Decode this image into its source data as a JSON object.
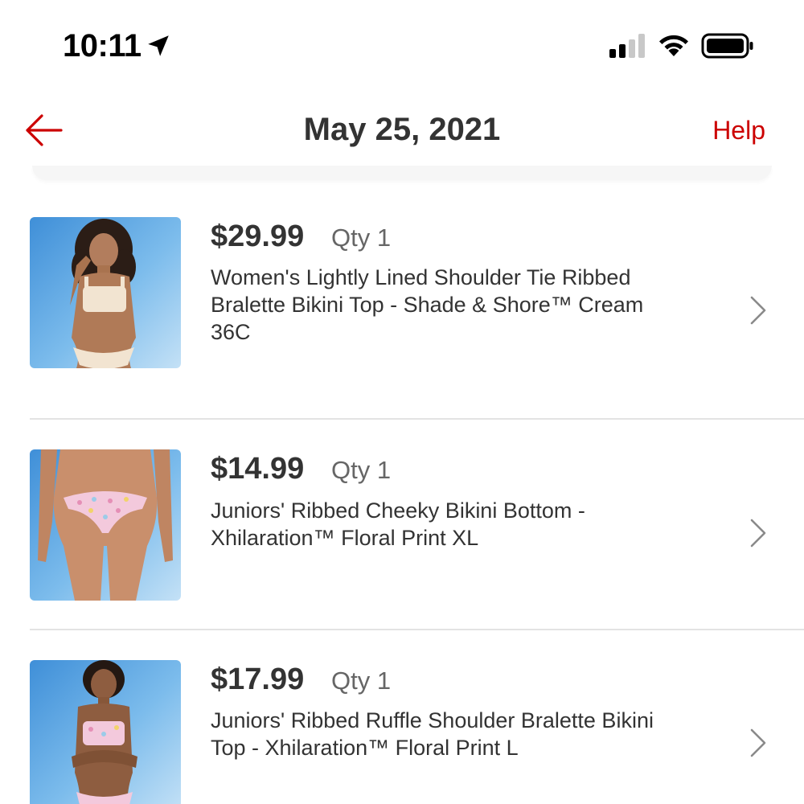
{
  "status_bar": {
    "time": "10:11",
    "location_icon": "location-arrow-icon",
    "signal_icon": "cellular-signal-icon",
    "wifi_icon": "wifi-icon",
    "battery_icon": "battery-icon"
  },
  "header": {
    "back_icon": "back-arrow-icon",
    "title": "May 25, 2021",
    "help_label": "Help"
  },
  "colors": {
    "accent_red": "#cc0000",
    "text_dark": "#333333",
    "text_muted": "#666666",
    "divider": "#e3e3e3"
  },
  "items": [
    {
      "price": "$29.99",
      "qty": "Qty 1",
      "title_line1": "Women's Lightly Lined Shoulder Tie Ribbed",
      "title_line2": "Bralette Bikini Top - Shade & Shore™ Cream",
      "title_line3": "36C",
      "image": "cream-bikini-product-photo"
    },
    {
      "price": "$14.99",
      "qty": "Qty 1",
      "title_line1": "Juniors' Ribbed Cheeky Bikini Bottom -",
      "title_line2": "Xhilaration™ Floral Print XL",
      "image": "floral-bikini-bottom-product-photo"
    },
    {
      "price": "$17.99",
      "qty": "Qty 1",
      "title_line1": "Juniors' Ribbed Ruffle Shoulder Bralette Bikini",
      "title_line2": "Top - Xhilaration™ Floral Print L",
      "image": "floral-bikini-top-product-photo"
    }
  ]
}
